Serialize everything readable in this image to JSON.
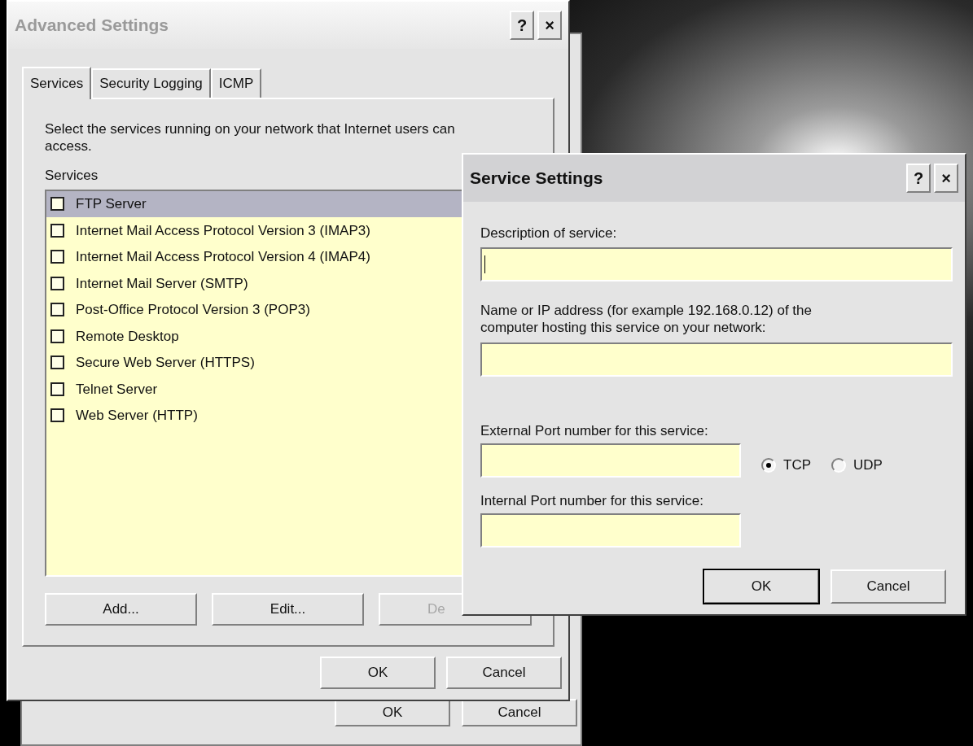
{
  "back_window": {
    "buttons": [
      {
        "label": "OK"
      },
      {
        "label": "Cancel"
      }
    ]
  },
  "advanced_settings": {
    "title": "Advanced Settings",
    "active": false,
    "title_buttons": [
      "?",
      "×"
    ],
    "tabs": [
      {
        "label": "Services",
        "selected": true
      },
      {
        "label": "Security Logging",
        "selected": false
      },
      {
        "label": "ICMP",
        "selected": false
      }
    ],
    "description": "Select the services running on your network that Internet users can access.",
    "list_label": "Services",
    "services": [
      {
        "label": "FTP Server",
        "checked": false,
        "selected": true
      },
      {
        "label": "Internet Mail Access Protocol Version 3 (IMAP3)",
        "checked": false,
        "selected": false
      },
      {
        "label": "Internet Mail Access Protocol Version 4 (IMAP4)",
        "checked": false,
        "selected": false
      },
      {
        "label": "Internet Mail Server (SMTP)",
        "checked": false,
        "selected": false
      },
      {
        "label": "Post-Office Protocol Version 3 (POP3)",
        "checked": false,
        "selected": false
      },
      {
        "label": "Remote Desktop",
        "checked": false,
        "selected": false
      },
      {
        "label": "Secure Web Server (HTTPS)",
        "checked": false,
        "selected": false
      },
      {
        "label": "Telnet Server",
        "checked": false,
        "selected": false
      },
      {
        "label": "Web Server (HTTP)",
        "checked": false,
        "selected": false
      }
    ],
    "list_buttons": [
      {
        "label": "Add...",
        "disabled": false
      },
      {
        "label": "Edit...",
        "disabled": false
      },
      {
        "label": "De",
        "disabled": true
      }
    ],
    "buttons": [
      {
        "label": "OK"
      },
      {
        "label": "Cancel"
      }
    ]
  },
  "service_settings": {
    "title": "Service Settings",
    "active": true,
    "title_buttons": [
      "?",
      "×"
    ],
    "description_field": {
      "label": "Description of service:",
      "focused": true
    },
    "host_field": {
      "label": "Name or IP address (for example 192.168.0.12) of the computer hosting this service on your network:",
      "focused": false
    },
    "external_port_field": {
      "label": "External Port number for this service:",
      "focused": false
    },
    "protocols": [
      {
        "label": "TCP",
        "selected": true
      },
      {
        "label": "UDP",
        "selected": false
      }
    ],
    "internal_port_field": {
      "label": "Internal Port number for this service:",
      "focused": false
    },
    "buttons": [
      {
        "label": "OK",
        "default": true
      },
      {
        "label": "Cancel",
        "default": false
      }
    ]
  }
}
